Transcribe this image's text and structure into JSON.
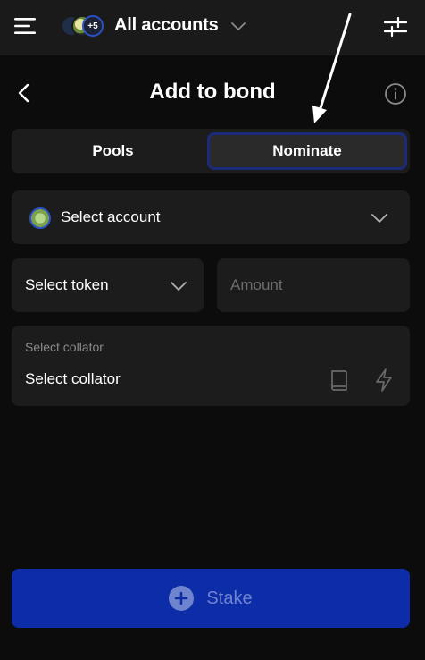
{
  "header": {
    "title": "All accounts",
    "avatar_overflow_count": "+5",
    "icons": [
      "menu-icon",
      "chevron-down-icon",
      "settings-sliders-icon"
    ]
  },
  "page": {
    "title": "Add to bond",
    "icons": [
      "back-arrow-icon",
      "info-icon"
    ]
  },
  "tabs": [
    {
      "label": "Pools",
      "selected": false
    },
    {
      "label": "Nominate",
      "selected": true
    }
  ],
  "form": {
    "account": {
      "label": "Select account"
    },
    "token": {
      "label": "Select token"
    },
    "amount": {
      "placeholder": "Amount",
      "value": ""
    },
    "collator": {
      "caption": "Select collator",
      "value": "Select collator",
      "icons": [
        "book-icon",
        "lightning-icon"
      ]
    }
  },
  "actions": {
    "stake_label": "Stake",
    "stake_icon": "plus-circle-icon"
  },
  "colors": {
    "background": "#0c0c0c",
    "header": "#1a1a1a",
    "field": "#1c1c1c",
    "selected_tab_border": "#1b2a7a",
    "accent": "#0d2da8",
    "stake_text": "#6f84cf",
    "placeholder": "#6c6c6c"
  }
}
